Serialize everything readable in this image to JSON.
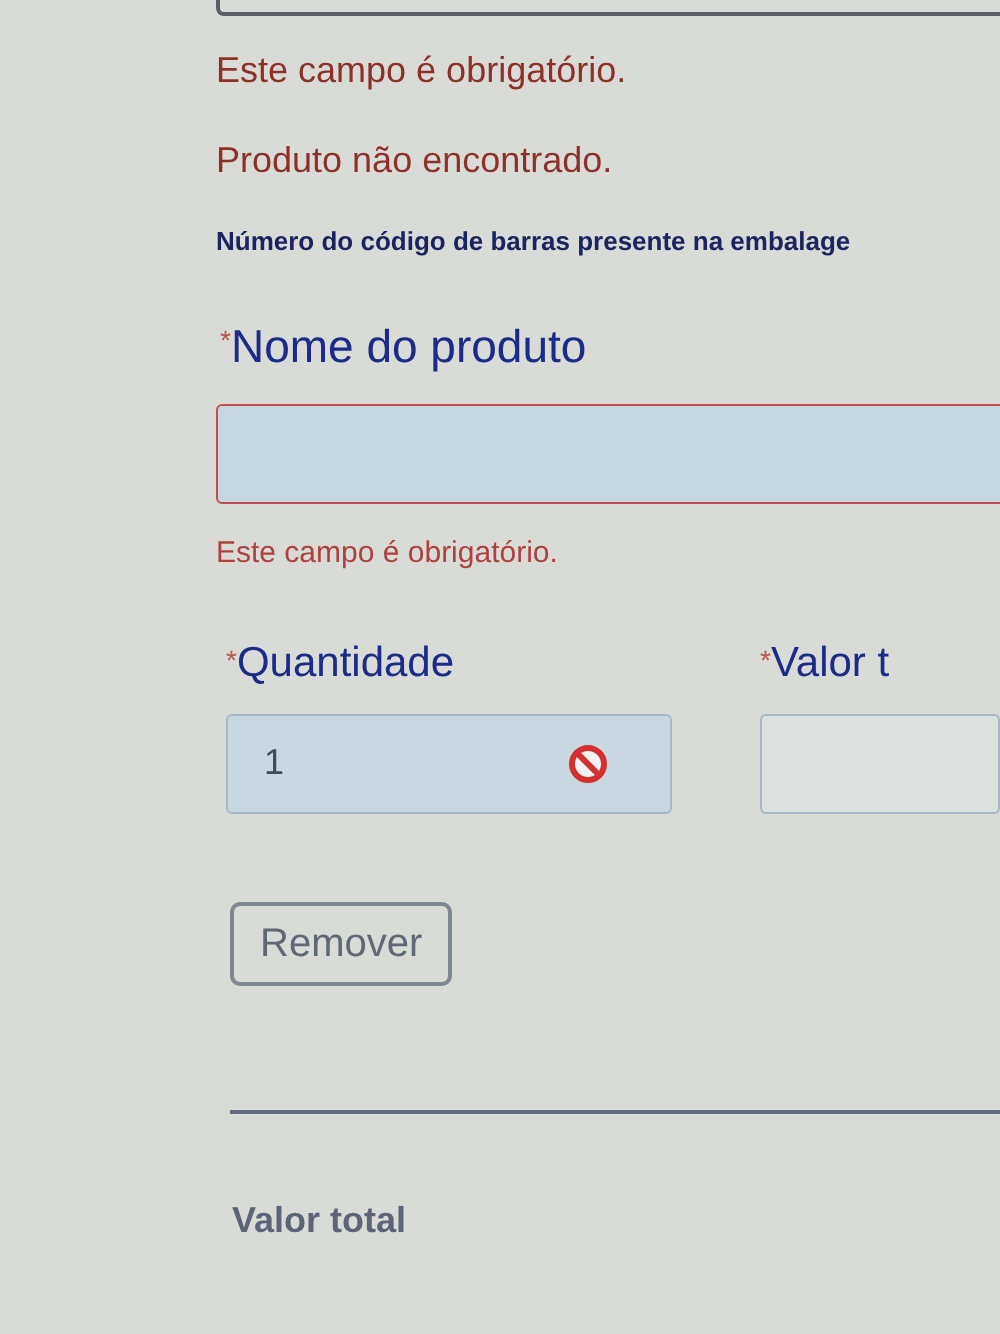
{
  "messages": [
    {
      "kind": "error",
      "text": "Este campo é obrigatório."
    },
    {
      "kind": "error",
      "text": "Produto não encontrado."
    },
    {
      "kind": "hint",
      "text": "Número do código de barras presente na embalage"
    }
  ],
  "product_name": {
    "marker": "*",
    "label": "Nome do produto",
    "invalid": true,
    "error": "Este campo é obrigatório."
  },
  "quantity": {
    "marker": "*",
    "label": "Quantidade",
    "value": "1",
    "disabled": true
  },
  "total_field": {
    "marker": "*",
    "label": "Valor t"
  },
  "remove_button": "Remover",
  "total_label": "Valor total"
}
